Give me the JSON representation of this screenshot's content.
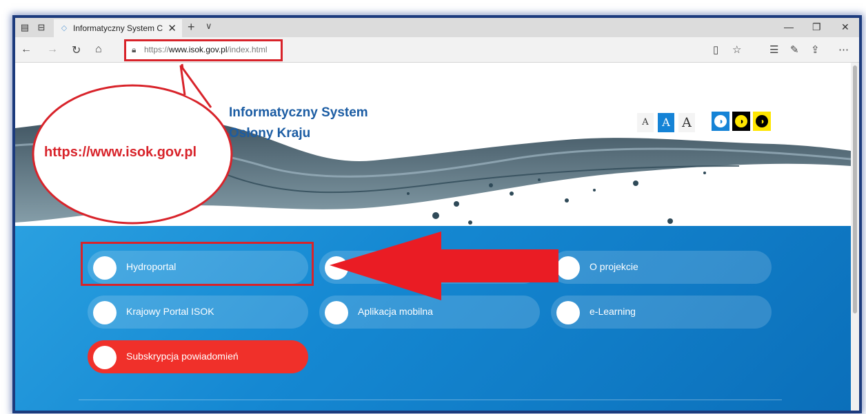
{
  "browser": {
    "tab_title": "Informatyczny System C",
    "address": "https://www.isok.gov.pl/index.html",
    "address_host": "https://www.isok.gov.pl",
    "address_path": "/index.html"
  },
  "header": {
    "title_line1": "Informatyczny System",
    "title_line2": "Osłony Kraju",
    "font_size_options": [
      "A",
      "A",
      "A"
    ]
  },
  "callout": {
    "text": "https://www.isok.gov.pl"
  },
  "tiles": [
    {
      "label": "Hydroportal"
    },
    {
      "label": "O projekcie"
    },
    {
      "label": "Krajowy Portal ISOK"
    },
    {
      "label": "Aplikacja mobilna"
    },
    {
      "label": "e-Learning"
    },
    {
      "label": "Subskrypcja powiadomień"
    }
  ],
  "colors": {
    "brand_blue": "#1b5ca3",
    "main_blue": "#1588d2",
    "highlight_red": "#d8232a",
    "subscribe_red": "#f0302a"
  },
  "icons": [
    "set-aside-tabs-icon",
    "tab-preview-icon",
    "back-icon",
    "forward-icon",
    "refresh-icon",
    "home-icon",
    "lock-icon",
    "reading-view-icon",
    "favorite-star-icon",
    "favorites-list-icon",
    "pen-icon",
    "share-icon",
    "more-icon",
    "contrast-icon"
  ]
}
